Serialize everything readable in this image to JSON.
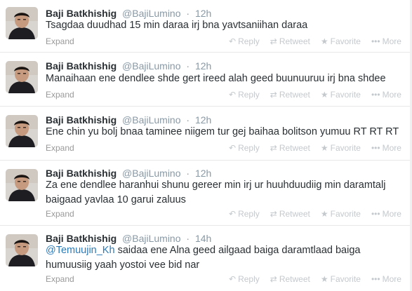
{
  "tweets": [
    {
      "fullname": "Baji Batkhishig",
      "username": "@BajiLumino",
      "separator": "·",
      "time": "12h",
      "text": "Tsagdaa duudhad 15 min daraa irj bna yavtsaniihan daraa",
      "mention": "",
      "expand": "Expand"
    },
    {
      "fullname": "Baji Batkhishig",
      "username": "@BajiLumino",
      "separator": "·",
      "time": "12h",
      "text": "Manaihaan ene dendlee shde gert ireed alah geed buunuuruu irj bna shdee",
      "mention": "",
      "expand": "Expand"
    },
    {
      "fullname": "Baji Batkhishig",
      "username": "@BajiLumino",
      "separator": "·",
      "time": "12h",
      "text": "Ene chin yu bolj bnaa taminee niigem tur gej baihaa  bolitson yumuu RT RT RT",
      "mention": "",
      "expand": "Expand"
    },
    {
      "fullname": "Baji Batkhishig",
      "username": "@BajiLumino",
      "separator": "·",
      "time": "12h",
      "text": "Za ene dendlee haranhui shunu gereer min irj ur huuhduudiig min daramtalj baigaad yavlaa 10 garui zaluus",
      "mention": "",
      "expand": "Expand"
    },
    {
      "fullname": "Baji Batkhishig",
      "username": "@BajiLumino",
      "separator": "·",
      "time": "14h",
      "text": " saidaa ene Alna geed ailgaad baiga daramtlaad baiga humuusiig yaah yostoi vee bid nar",
      "mention": "@Temuujin_Kh",
      "expand": "Expand"
    }
  ],
  "actions": {
    "reply": "Reply",
    "retweet": "Retweet",
    "favorite": "Favorite",
    "more": "More"
  },
  "icons": {
    "reply": "reply-arrow-icon",
    "retweet": "retweet-icon",
    "favorite": "star-icon",
    "more": "ellipsis-icon"
  },
  "colors": {
    "name": "#292f33",
    "meta": "#8899a6",
    "mention": "#2b7bb9",
    "action": "#c4c9cd",
    "divider": "#e8e8e8"
  }
}
